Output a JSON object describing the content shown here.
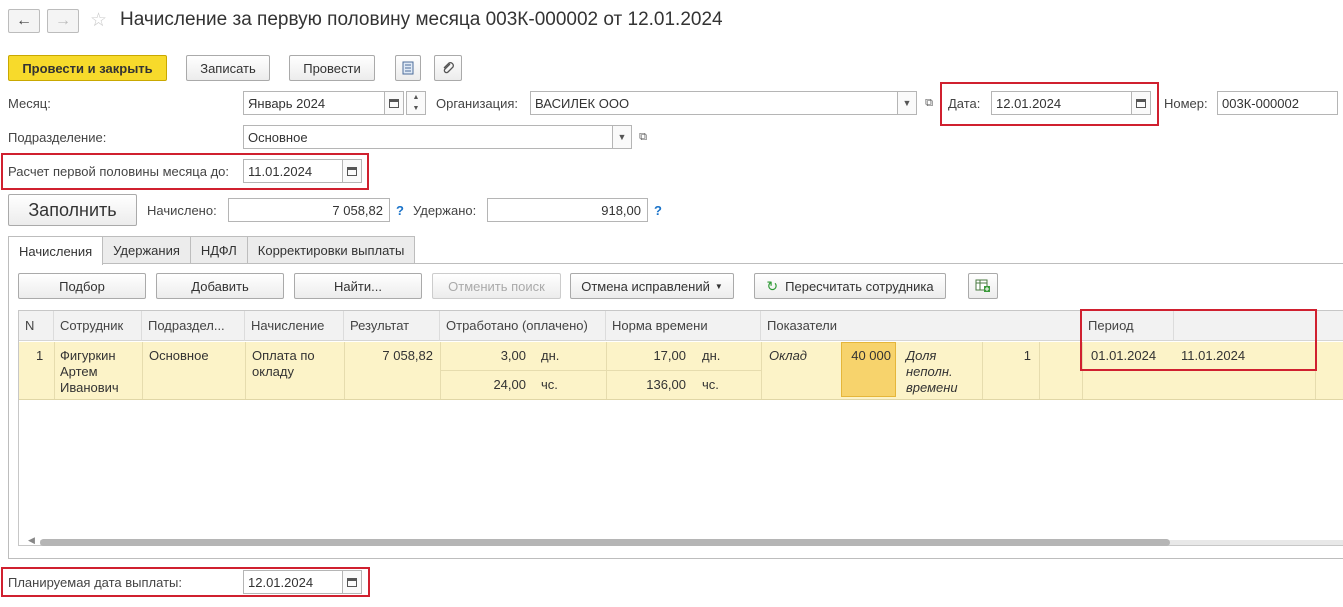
{
  "window": {
    "title": "Начисление за первую половину месяца 003К-000002 от 12.01.2024"
  },
  "toolbar": {
    "post_and_close": "Провести и закрыть",
    "save": "Записать",
    "post": "Провести"
  },
  "header": {
    "month_label": "Месяц:",
    "month_value": "Январь 2024",
    "org_label": "Организация:",
    "org_value": "ВАСИЛЕК ООО",
    "date_label": "Дата:",
    "date_value": "12.01.2024",
    "number_label": "Номер:",
    "number_value": "003К-000002",
    "dept_label": "Подразделение:",
    "dept_value": "Основное",
    "calc_until_label": "Расчет первой половины месяца до:",
    "calc_until_value": "11.01.2024"
  },
  "totals": {
    "fill_button": "Заполнить",
    "accrued_label": "Начислено:",
    "accrued_value": "7 058,82",
    "withheld_label": "Удержано:",
    "withheld_value": "918,00",
    "help": "?"
  },
  "tabs": [
    {
      "label": "Начисления",
      "active": true
    },
    {
      "label": "Удержания",
      "active": false
    },
    {
      "label": "НДФЛ",
      "active": false
    },
    {
      "label": "Корректировки выплаты",
      "active": false
    }
  ],
  "grid_toolbar": {
    "select": "Подбор",
    "add": "Добавить",
    "find": "Найти...",
    "cancel_search": "Отменить поиск",
    "cancel_corrections": "Отмена исправлений",
    "recalc": "Пересчитать сотрудника"
  },
  "grid": {
    "columns": [
      "N",
      "Сотрудник",
      "Подраздел...",
      "Начисление",
      "Результат",
      "Отработано (оплачено)",
      "Норма времени",
      "Показатели",
      "Период"
    ],
    "row": {
      "n": "1",
      "employee_line1": "Фигуркин",
      "employee_line2": "Артем",
      "employee_line3": "Иванович",
      "department": "Основное",
      "accrual_line1": "Оплата по",
      "accrual_line2": "окладу",
      "result": "7 058,82",
      "worked_days": "3,00",
      "worked_days_unit": "дн.",
      "worked_hours": "24,00",
      "worked_hours_unit": "чс.",
      "norm_days": "17,00",
      "norm_days_unit": "дн.",
      "norm_hours": "136,00",
      "norm_hours_unit": "чс.",
      "indicator_name": "Оклад",
      "indicator_value": "40 000",
      "part_time_line1": "Доля",
      "part_time_line2": "неполн.",
      "part_time_line3": "времени",
      "part_time_value": "1",
      "period_start": "01.01.2024",
      "period_end": "11.01.2024"
    }
  },
  "footer": {
    "planned_date_label": "Планируемая дата выплаты:",
    "planned_date_value": "12.01.2024"
  }
}
